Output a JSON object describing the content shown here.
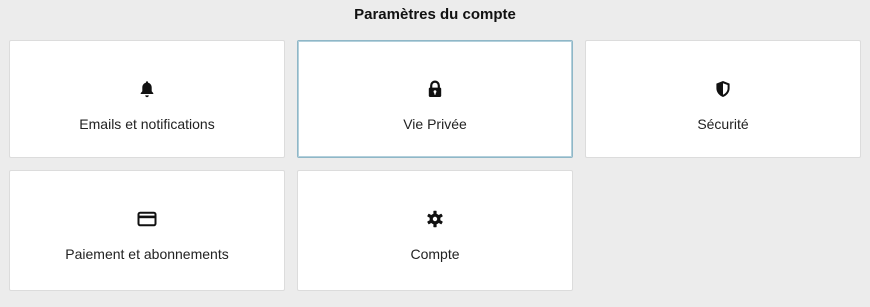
{
  "header": {
    "title": "Paramètres du compte"
  },
  "tiles": [
    {
      "label": "Emails et notifications",
      "icon": "bell-icon"
    },
    {
      "label": "Vie Privée",
      "icon": "lock-icon"
    },
    {
      "label": "Sécurité",
      "icon": "shield-icon"
    },
    {
      "label": "Paiement et abonnements",
      "icon": "credit-card-icon"
    },
    {
      "label": "Compte",
      "icon": "gear-icon"
    }
  ],
  "colors": {
    "background": "#ececec",
    "tile": "#ffffff",
    "active_border": "#8fb7c7",
    "text": "#222222"
  }
}
